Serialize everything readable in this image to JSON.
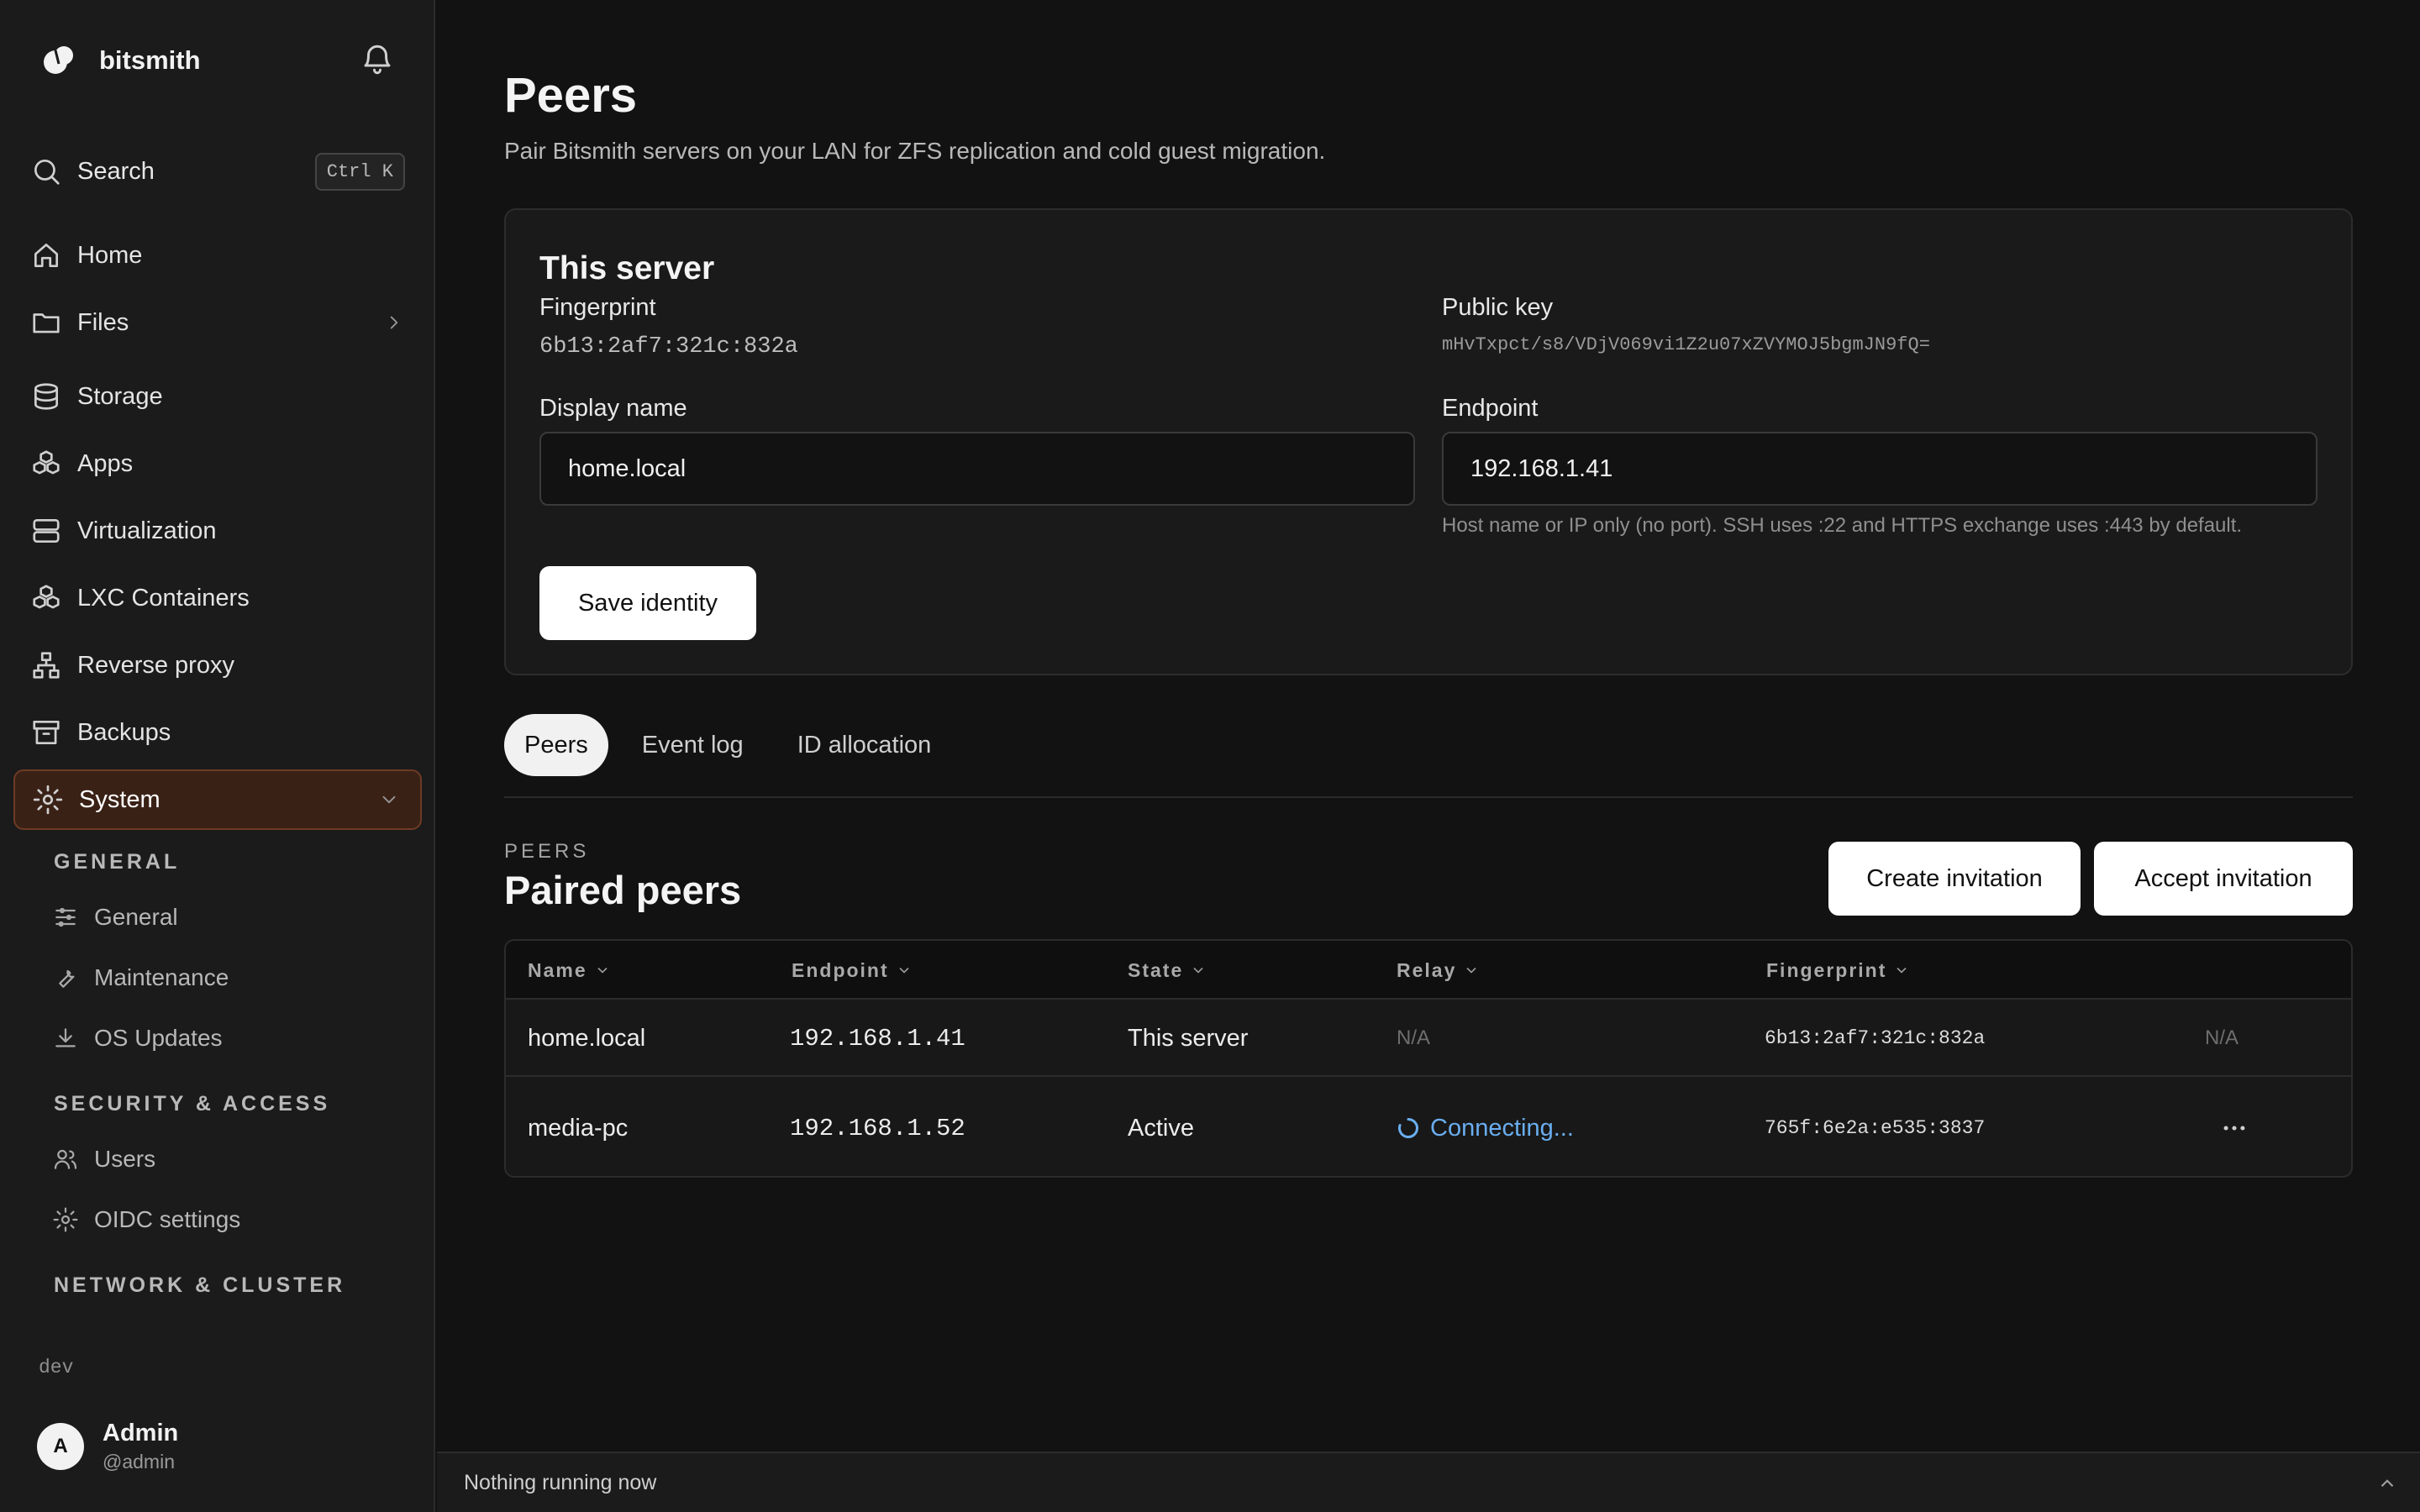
{
  "app": {
    "name": "bitsmith"
  },
  "search": {
    "label": "Search",
    "shortcut": "Ctrl K"
  },
  "nav": {
    "home": "Home",
    "files": "Files",
    "storage": "Storage",
    "apps": "Apps",
    "virtualization": "Virtualization",
    "lxc": "LXC Containers",
    "reverse_proxy": "Reverse proxy",
    "backups": "Backups",
    "system": "System"
  },
  "system_menu": {
    "general_heading": "GENERAL",
    "general": "General",
    "maintenance": "Maintenance",
    "os_updates": "OS Updates",
    "security_heading": "SECURITY & ACCESS",
    "users": "Users",
    "oidc": "OIDC settings",
    "network_heading": "NETWORK & CLUSTER"
  },
  "env_label": "dev",
  "user": {
    "initial": "A",
    "name": "Admin",
    "handle": "@admin"
  },
  "page": {
    "title": "Peers",
    "subtitle": "Pair Bitsmith servers on your LAN for ZFS replication and cold guest migration."
  },
  "this_server": {
    "title": "This server",
    "fingerprint_label": "Fingerprint",
    "fingerprint": "6b13:2af7:321c:832a",
    "public_key_label": "Public key",
    "public_key": "mHvTxpct/s8/VDjV069vi1Z2u07xZVYMOJ5bgmJN9fQ=",
    "display_name_label": "Display name",
    "display_name": "home.local",
    "endpoint_label": "Endpoint",
    "endpoint": "192.168.1.41",
    "endpoint_hint": "Host name or IP only (no port). SSH uses :22 and HTTPS exchange uses :443 by default.",
    "save_label": "Save identity"
  },
  "tabs": [
    "Peers",
    "Event log",
    "ID allocation"
  ],
  "peers_section": {
    "eyebrow": "PEERS",
    "title": "Paired peers",
    "create_label": "Create invitation",
    "accept_label": "Accept invitation"
  },
  "table": {
    "columns": [
      "Name",
      "Endpoint",
      "State",
      "Relay",
      "Fingerprint"
    ],
    "rows": [
      {
        "name": "home.local",
        "endpoint": "192.168.1.41",
        "state": "This server",
        "relay": "N/A",
        "fingerprint": "6b13:2af7:321c:832a",
        "action": "N/A"
      },
      {
        "name": "media-pc",
        "endpoint": "192.168.1.52",
        "state": "Active",
        "relay": "Connecting...",
        "fingerprint": "765f:6e2a:e535:3837",
        "action": "more"
      }
    ]
  },
  "footer": {
    "status": "Nothing running now"
  },
  "colors": {
    "accent": "#3a2116",
    "accent_border": "#6e3b25",
    "link": "#6aaef0"
  }
}
